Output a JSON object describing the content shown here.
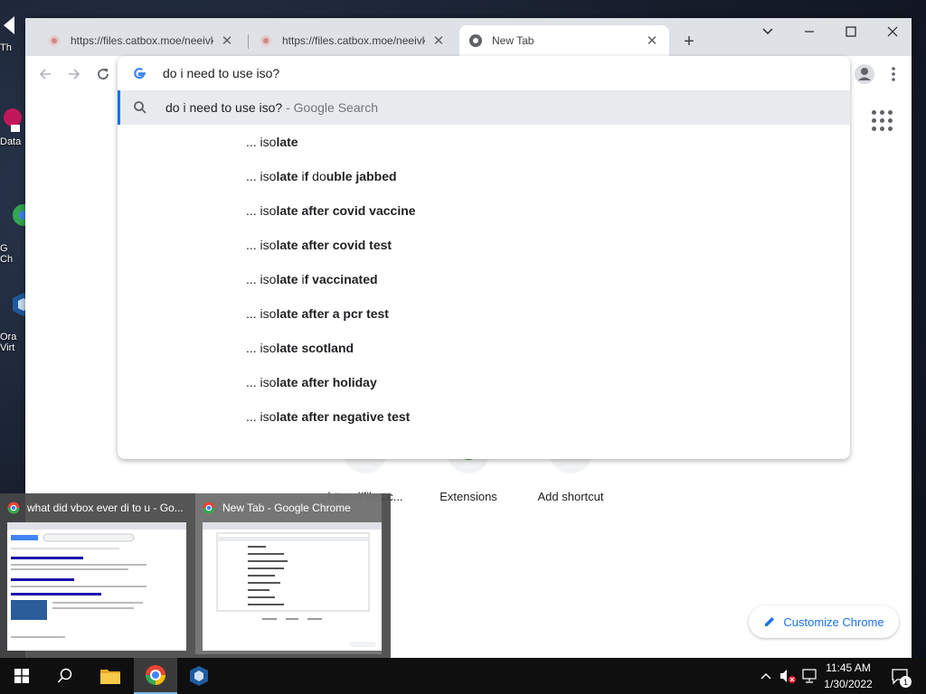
{
  "browser": {
    "tabs": [
      {
        "title": "https://files.catbox.moe/neeivk.t",
        "active": false
      },
      {
        "title": "https://files.catbox.moe/neeivk.t",
        "active": false
      },
      {
        "title": "New Tab",
        "active": true
      }
    ],
    "tab_close_glyph": "✕",
    "new_tab_glyph": "+"
  },
  "omnibox": {
    "query": "do i need to use iso?",
    "search_row": {
      "text": "do i need to use iso?",
      "hint": " - Google Search"
    },
    "suggestions": [
      {
        "prefix": "... iso",
        "segments": [
          {
            "t": "late",
            "b": true
          }
        ]
      },
      {
        "prefix": "... iso",
        "segments": [
          {
            "t": "late",
            "b": true
          },
          {
            "t": " i",
            "b": false
          },
          {
            "t": "f",
            "b": true
          },
          {
            "t": " d",
            "b": false
          },
          {
            "t": "o",
            "b": false
          },
          {
            "t": "uble jabbed",
            "b": true
          }
        ]
      },
      {
        "prefix": "... iso",
        "segments": [
          {
            "t": "late after covid vaccine",
            "b": true
          }
        ]
      },
      {
        "prefix": "... iso",
        "segments": [
          {
            "t": "late after covid test",
            "b": true
          }
        ]
      },
      {
        "prefix": "... iso",
        "segments": [
          {
            "t": "late ",
            "b": true
          },
          {
            "t": "i",
            "b": false
          },
          {
            "t": "f vaccinated",
            "b": true
          }
        ]
      },
      {
        "prefix": "... iso",
        "segments": [
          {
            "t": "late after a pcr test",
            "b": true
          }
        ]
      },
      {
        "prefix": "... iso",
        "segments": [
          {
            "t": "late scotland",
            "b": true
          }
        ]
      },
      {
        "prefix": "... iso",
        "segments": [
          {
            "t": "late after holiday",
            "b": true
          }
        ]
      },
      {
        "prefix": "... iso",
        "segments": [
          {
            "t": "late after negative test",
            "b": true
          }
        ]
      }
    ]
  },
  "ntp": {
    "shortcuts": [
      {
        "label": "https://files.c..."
      },
      {
        "label": "Extensions"
      },
      {
        "label": "Add shortcut"
      }
    ],
    "customize_label": "Customize Chrome"
  },
  "desktop_icons": [
    {
      "label": "Th"
    },
    {
      "label": "Data"
    },
    {
      "label": "G\nCh"
    },
    {
      "label": "Ora\nVirt"
    }
  ],
  "taskbar": {
    "previews": [
      {
        "title": "what did vbox ever di to u - Go..."
      },
      {
        "title": "New Tab - Google Chrome"
      }
    ],
    "clock": {
      "time": "11:45 AM",
      "date": "1/30/2022"
    },
    "notification_count": "1"
  },
  "colors": {
    "accent": "#1a73e8",
    "tabstrip": "#dee1e6",
    "selected_row": "#e8eaed"
  }
}
